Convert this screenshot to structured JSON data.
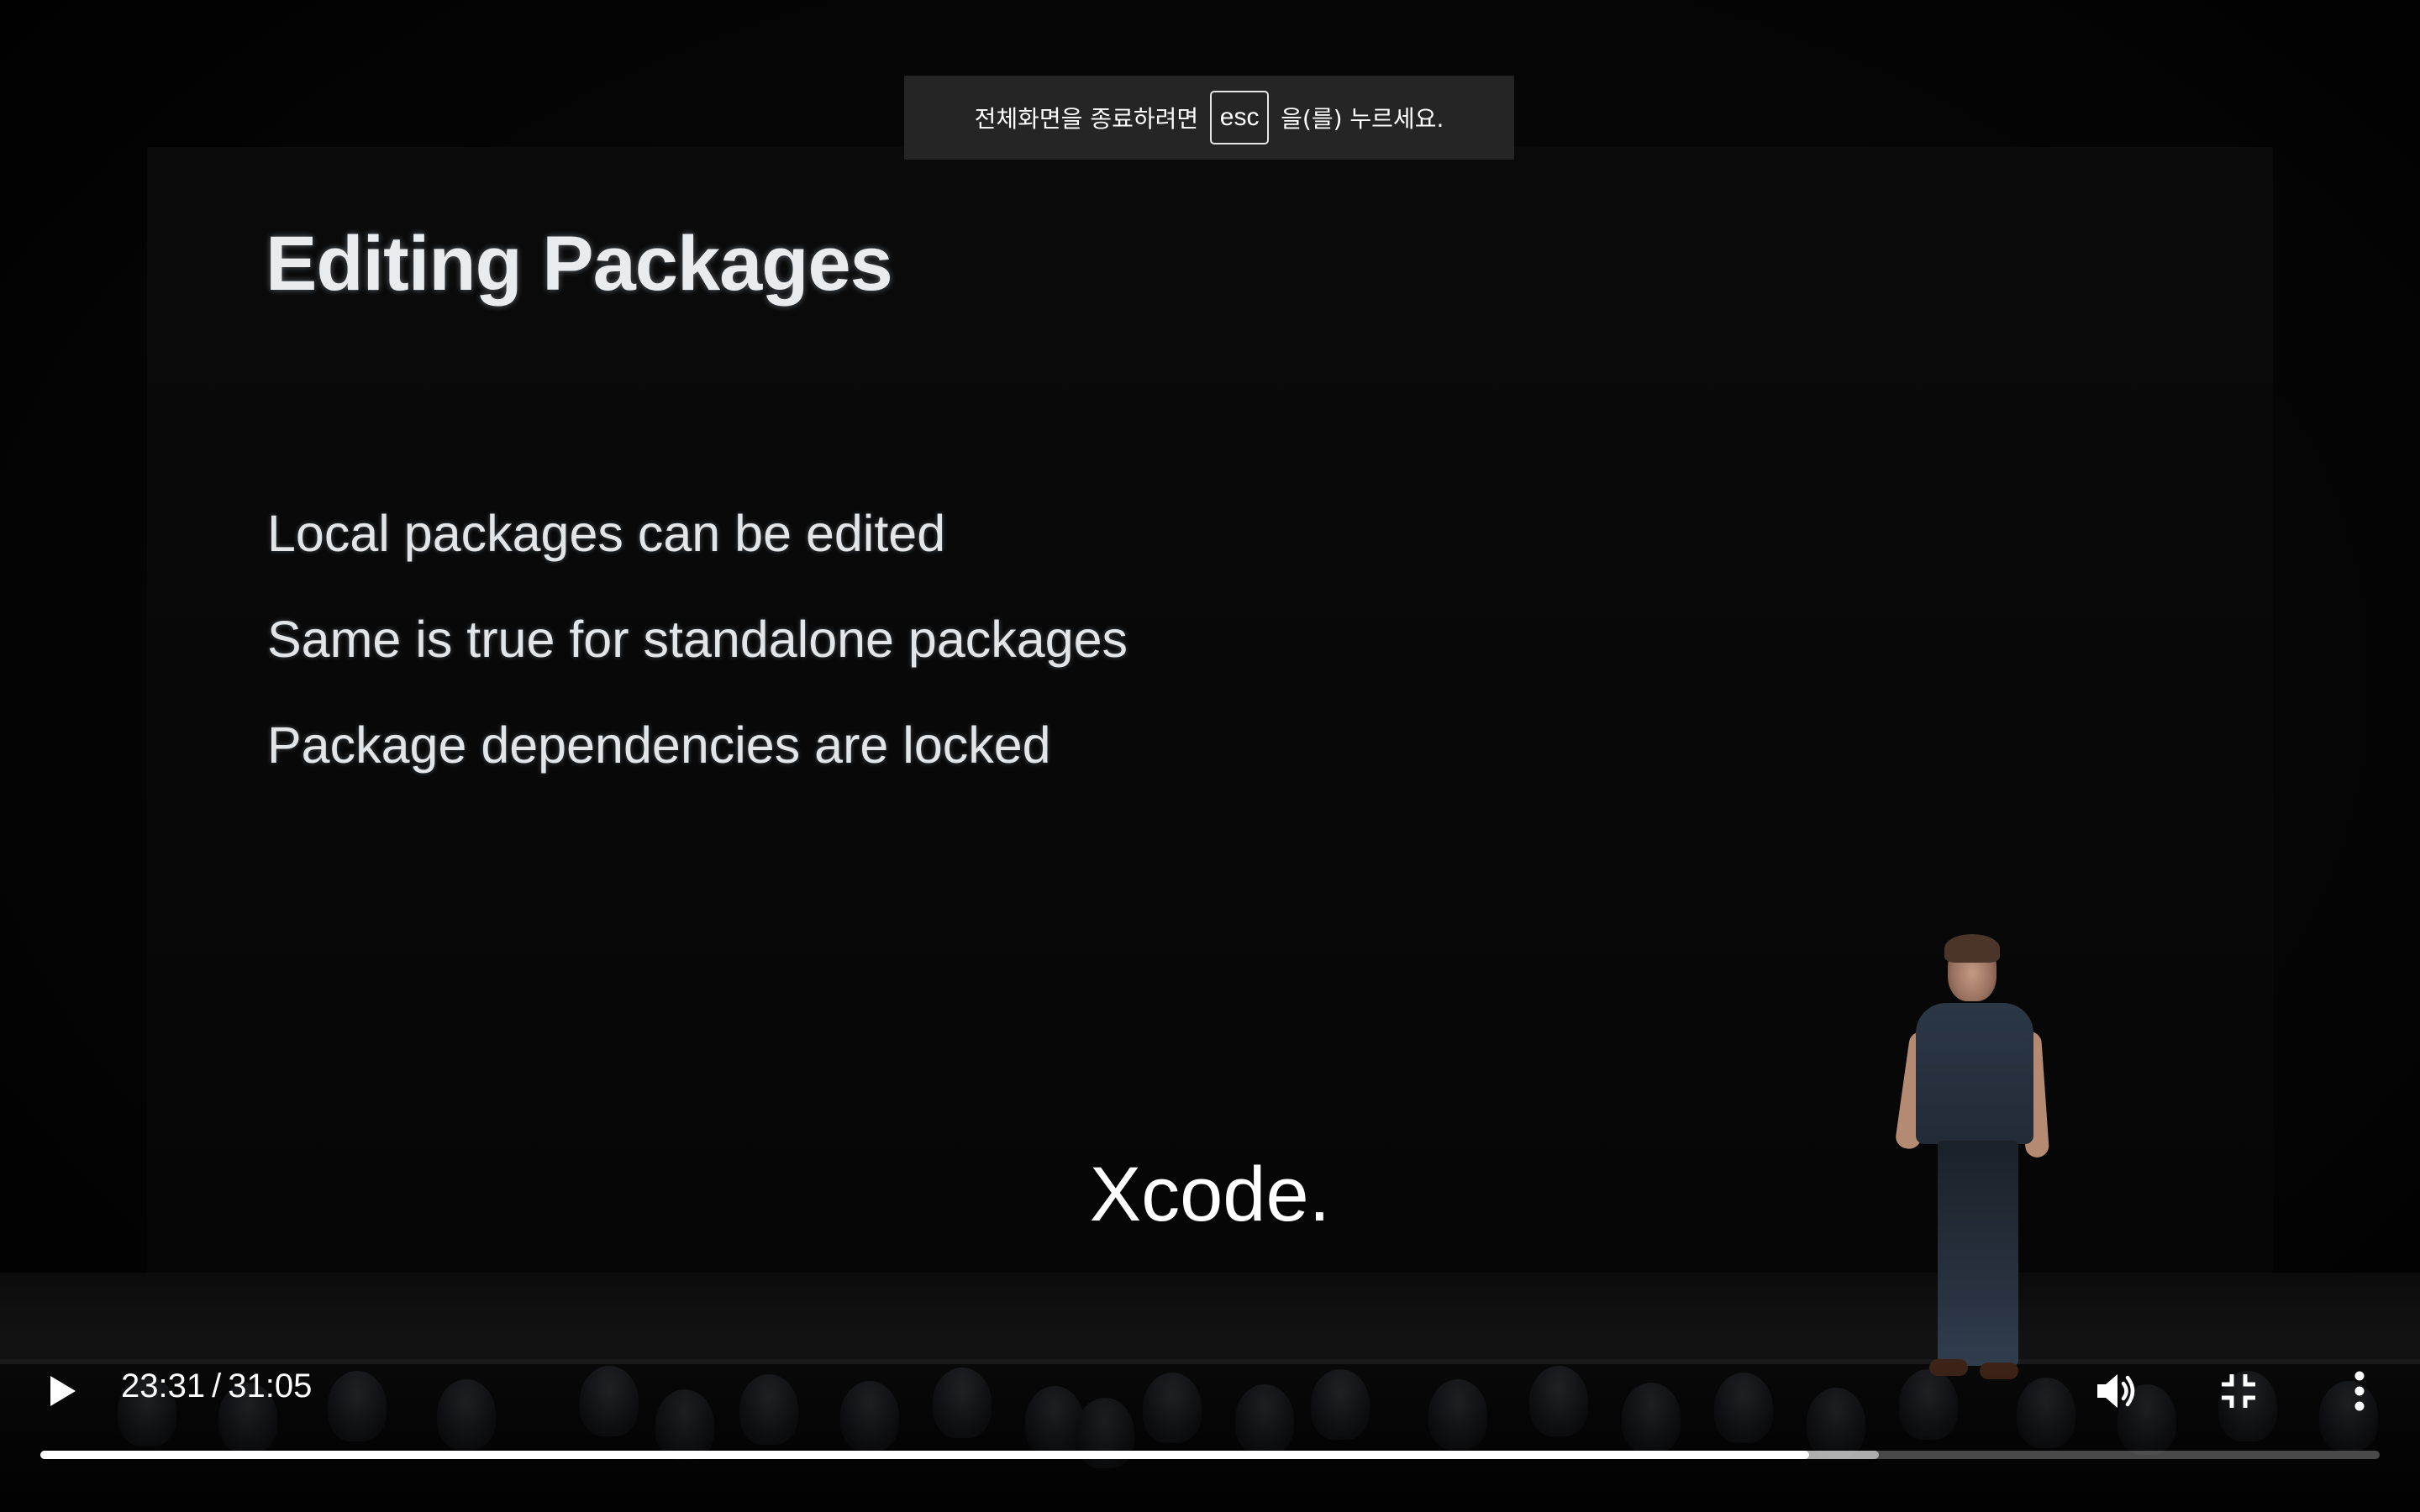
{
  "fullscreen_notice": {
    "prefix": "전체화면을 종료하려면",
    "key": "esc",
    "suffix": "을(를) 누르세요."
  },
  "slide": {
    "title": "Editing Packages",
    "bullets": [
      "Local packages can be edited",
      "Same is true for standalone packages",
      "Package dependencies are locked"
    ]
  },
  "caption": "Xcode.",
  "controls": {
    "current_time": "23:31",
    "separator": "/",
    "duration": "31:05",
    "progress_played_fraction": 0.756,
    "progress_buffered_fraction": 0.786,
    "icons": {
      "play": "play-icon",
      "volume": "volume-icon",
      "exit_fullscreen": "exit-fullscreen-icon",
      "more": "more-vert-icon"
    }
  },
  "colors": {
    "notice_bg": "#262628",
    "progress_played": "#ffffff",
    "slide_text": "#e8ecef"
  }
}
